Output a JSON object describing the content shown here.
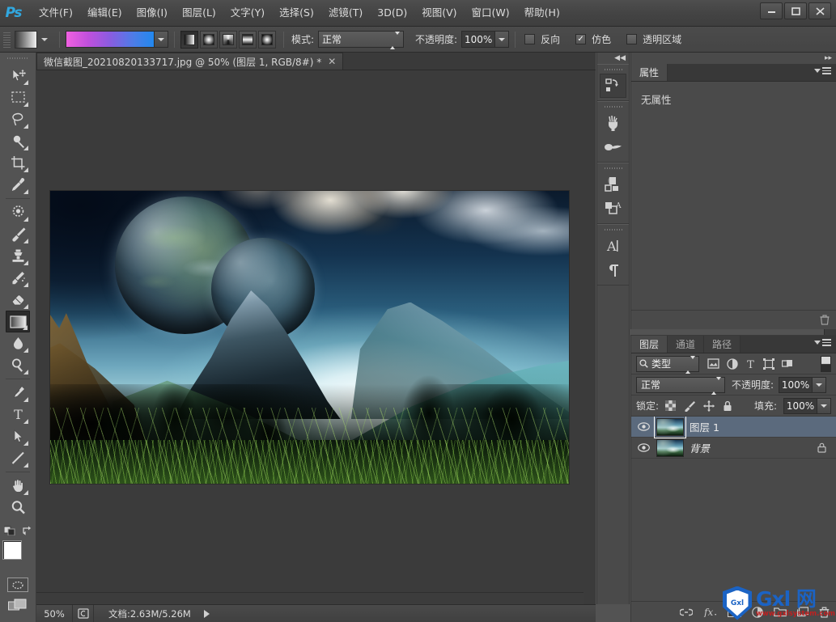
{
  "app": {
    "name": "Adobe Photoshop",
    "logo_text": "Ps"
  },
  "menubar": {
    "items": [
      {
        "label": "文件(F)",
        "name": "menu-file"
      },
      {
        "label": "编辑(E)",
        "name": "menu-edit"
      },
      {
        "label": "图像(I)",
        "name": "menu-image"
      },
      {
        "label": "图层(L)",
        "name": "menu-layer"
      },
      {
        "label": "文字(Y)",
        "name": "menu-type"
      },
      {
        "label": "选择(S)",
        "name": "menu-select"
      },
      {
        "label": "滤镜(T)",
        "name": "menu-filter"
      },
      {
        "label": "3D(D)",
        "name": "menu-3d"
      },
      {
        "label": "视图(V)",
        "name": "menu-view"
      },
      {
        "label": "窗口(W)",
        "name": "menu-window"
      },
      {
        "label": "帮助(H)",
        "name": "menu-help"
      }
    ]
  },
  "window_controls": {
    "minimize": "—",
    "maximize": "❐",
    "close": "✕"
  },
  "options_bar": {
    "tool": "gradient-tool",
    "gradient_colors": {
      "start": "#f060e0",
      "end": "#2288ee"
    },
    "gradient_types": [
      "linear",
      "radial",
      "angle",
      "reflected",
      "diamond"
    ],
    "active_gradient_type": "linear",
    "mode_label": "模式:",
    "mode_value": "正常",
    "opacity_label": "不透明度:",
    "opacity_value": "100%",
    "reverse_label": "反向",
    "reverse_checked": false,
    "dither_label": "仿色",
    "dither_checked": true,
    "transparency_label": "透明区域",
    "transparency_checked": false
  },
  "document_tab": {
    "title": "微信截图_20210820133717.jpg @ 50% (图层 1, RGB/8#) *",
    "close": "✕"
  },
  "toolbar": {
    "tools": [
      {
        "name": "move-tool",
        "label": "移动工具"
      },
      {
        "name": "marquee-tool",
        "label": "矩形选框工具"
      },
      {
        "name": "lasso-tool",
        "label": "套索工具"
      },
      {
        "name": "magic-wand-tool",
        "label": "快速选择工具"
      },
      {
        "name": "crop-tool",
        "label": "裁剪工具"
      },
      {
        "name": "eyedropper-tool",
        "label": "吸管工具"
      },
      {
        "name": "healing-brush-tool",
        "label": "污点修复画笔工具"
      },
      {
        "name": "brush-tool",
        "label": "画笔工具"
      },
      {
        "name": "clone-stamp-tool",
        "label": "仿制图章工具"
      },
      {
        "name": "history-brush-tool",
        "label": "历史记录画笔工具"
      },
      {
        "name": "eraser-tool",
        "label": "橡皮擦工具"
      },
      {
        "name": "gradient-tool",
        "label": "渐变工具"
      },
      {
        "name": "blur-tool",
        "label": "模糊工具"
      },
      {
        "name": "dodge-tool",
        "label": "减淡工具"
      },
      {
        "name": "pen-tool",
        "label": "钢笔工具"
      },
      {
        "name": "type-tool",
        "label": "横排文字工具"
      },
      {
        "name": "path-selection-tool",
        "label": "路径选择工具"
      },
      {
        "name": "line-tool",
        "label": "直线工具"
      },
      {
        "name": "hand-tool",
        "label": "抓手工具"
      },
      {
        "name": "zoom-tool",
        "label": "缩放工具"
      }
    ],
    "active_tool": "gradient-tool",
    "foreground_color": "#ffffff",
    "background_color": "#000000"
  },
  "right_dock": {
    "items": [
      {
        "name": "history-icon",
        "label": "历史记录"
      },
      {
        "name": "brush-icon",
        "label": "画笔"
      },
      {
        "name": "brush-presets-icon",
        "label": "画笔预设"
      },
      {
        "name": "adjustments-icon",
        "label": "调整"
      },
      {
        "name": "styles-icon",
        "label": "样式"
      },
      {
        "name": "character-icon",
        "label": "字符"
      },
      {
        "name": "paragraph-icon",
        "label": "段落"
      }
    ]
  },
  "properties_panel": {
    "tab_label": "属性",
    "empty_text": "无属性"
  },
  "layers_panel": {
    "tabs": [
      {
        "label": "图层",
        "active": true
      },
      {
        "label": "通道",
        "active": false
      },
      {
        "label": "路径",
        "active": false
      }
    ],
    "filter_value": "类型",
    "blend_mode": "正常",
    "opacity_label": "不透明度:",
    "opacity_value": "100%",
    "lock_label": "锁定:",
    "fill_label": "填充:",
    "fill_value": "100%",
    "rows": [
      {
        "name": "图层 1",
        "visible": true,
        "selected": true,
        "locked": false,
        "italic": false
      },
      {
        "name": "背景",
        "visible": true,
        "selected": false,
        "locked": true,
        "italic": true
      }
    ]
  },
  "status_bar": {
    "zoom": "50%",
    "doc_info": "文档:2.63M/5.26M"
  },
  "watermark": {
    "shield_text": "Gxl",
    "main_text": "Gxl 网",
    "url": "www.gxlsystem.com",
    "brand_color": "#1b63c4"
  },
  "canvas": {
    "image_description": "幻想风景：天空中的行星、雪山、发光山谷与前景草地"
  }
}
